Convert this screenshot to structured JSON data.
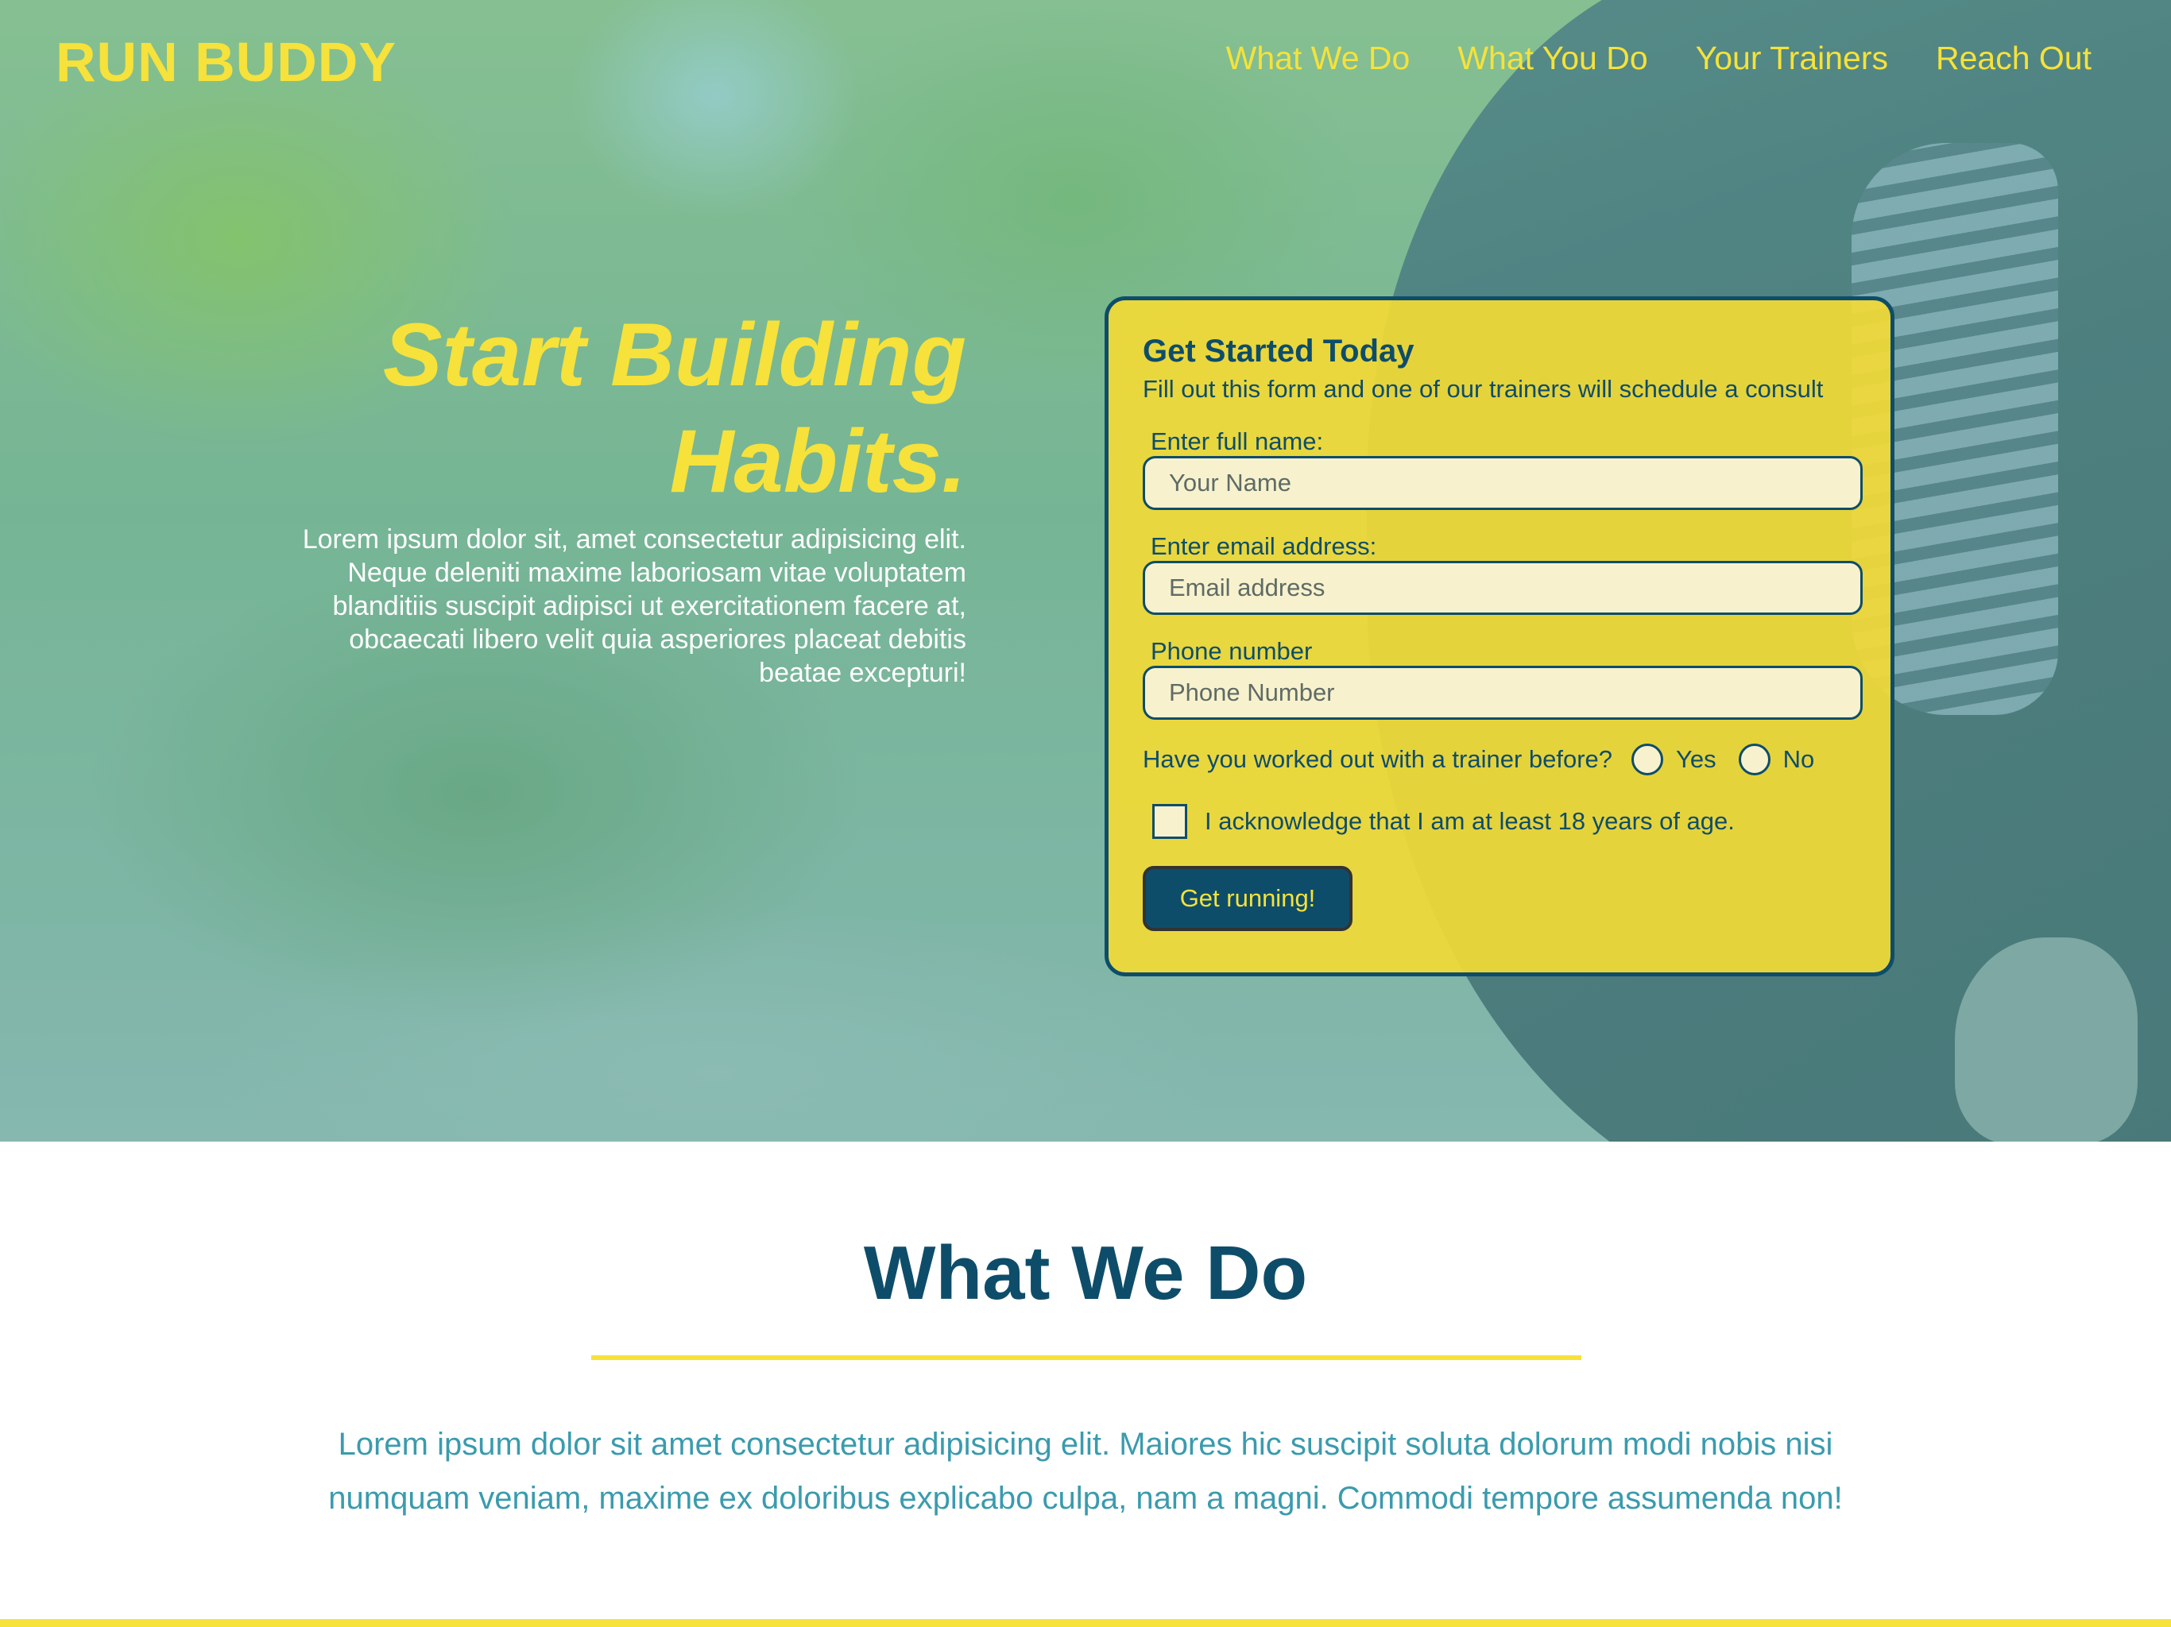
{
  "header": {
    "logo": "RUN BUDDY",
    "nav": [
      "What We Do",
      "What You Do",
      "Your Trainers",
      "Reach Out"
    ]
  },
  "hero": {
    "title_line1": "Start Building",
    "title_line2": "Habits.",
    "body": "Lorem ipsum dolor sit, amet consectetur adipisicing elit. Neque deleniti maxime laboriosam vitae voluptatem blanditiis suscipit adipisci ut exercitationem facere at, obcaecati libero velit quia asperiores placeat debitis beatae excepturi!"
  },
  "form": {
    "title": "Get Started Today",
    "subtitle": "Fill out this form and one of our trainers will schedule a consult",
    "name_label": "Enter full name:",
    "name_placeholder": "Your Name",
    "email_label": "Enter email address:",
    "email_placeholder": "Email address",
    "phone_label": "Phone number",
    "phone_placeholder": "Phone Number",
    "trainer_question": "Have you worked out with a trainer before?",
    "yes_label": "Yes",
    "no_label": "No",
    "age_ack": "I acknowledge that I am at least 18 years of age.",
    "submit_label": "Get running!"
  },
  "what_we_do": {
    "title": "What We Do",
    "body": "Lorem ipsum dolor sit amet consectetur adipisicing elit. Maiores hic suscipit soluta dolorum modi nobis nisi numquam veniam, maxime ex doloribus explicabo culpa, nam a magni. Commodi tempore assumenda non!"
  },
  "colors": {
    "accent_yellow": "#f6e23a",
    "primary_blue": "#0e4d6a",
    "text_teal": "#3a9bae"
  }
}
